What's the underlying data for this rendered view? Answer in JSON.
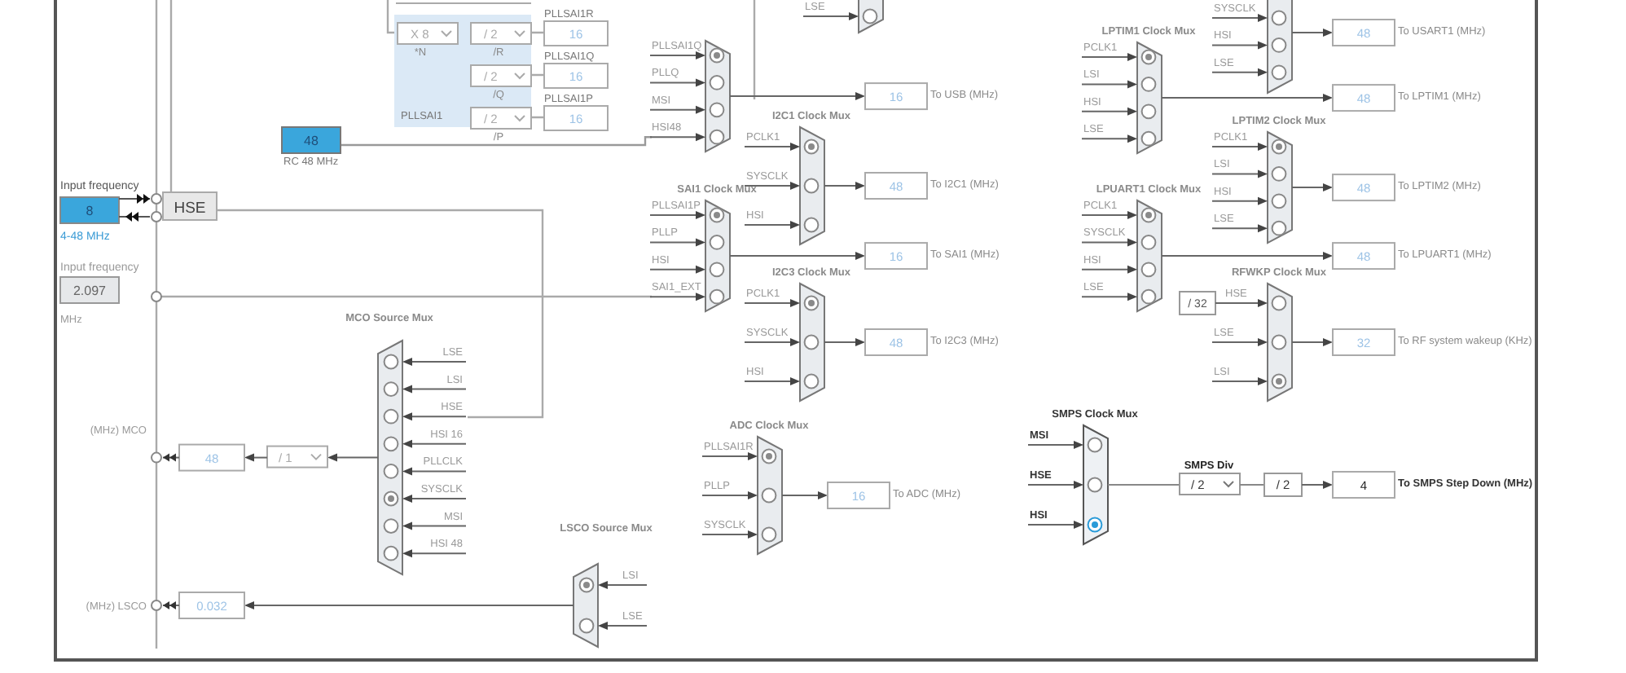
{
  "hse_input": {
    "label": "Input frequency",
    "value": "8",
    "range": "4-48 MHz",
    "source": "HSE",
    "disabled": false
  },
  "input_2": {
    "label": "Input frequency",
    "value": "2.097",
    "unit": "MHz",
    "disabled": true
  },
  "rc48": {
    "value": "48",
    "label": "RC 48 MHz"
  },
  "pllsai1": {
    "title": "PLLSAI1",
    "multiplier": {
      "value": "X 8",
      "label": "*N"
    },
    "dividers": [
      {
        "value": "/ 2",
        "label": "/R"
      },
      {
        "value": "/ 2",
        "label": "/Q"
      },
      {
        "value": "/ 2",
        "label": "/P"
      }
    ],
    "outputs": [
      {
        "label": "PLLSAI1R",
        "value": "16"
      },
      {
        "label": "PLLSAI1Q",
        "value": "16"
      },
      {
        "label": "PLLSAI1P",
        "value": "16"
      }
    ]
  },
  "muxes": [
    {
      "disabled": true,
      "inputs": [
        {
          "label": "LSE",
          "selected": false
        }
      ]
    },
    {
      "disabled": true,
      "inputs": [
        {
          "label": "PLLSAI1Q",
          "selected": true
        },
        {
          "label": "PLLQ",
          "selected": false
        },
        {
          "label": "MSI",
          "selected": false
        },
        {
          "label": "HSI48",
          "selected": false
        }
      ],
      "output": {
        "value": "16",
        "label": "To USB (MHz)"
      }
    },
    {
      "title": "I2C1 Clock Mux",
      "disabled": true,
      "inputs": [
        {
          "label": "PCLK1",
          "selected": true
        },
        {
          "label": "SYSCLK",
          "selected": false
        },
        {
          "label": "HSI",
          "selected": false
        }
      ],
      "output": {
        "value": "48",
        "label": "To I2C1 (MHz)"
      }
    },
    {
      "title": "SAI1 Clock Mux",
      "disabled": true,
      "inputs": [
        {
          "label": "PLLSAI1P",
          "selected": true
        },
        {
          "label": "PLLP",
          "selected": false
        },
        {
          "label": "HSI",
          "selected": false
        },
        {
          "label": "SAI1_EXT",
          "selected": false
        }
      ],
      "output": {
        "value": "16",
        "label": "To SAI1 (MHz)"
      }
    },
    {
      "title": "I2C3 Clock Mux",
      "disabled": true,
      "inputs": [
        {
          "label": "PCLK1",
          "selected": true
        },
        {
          "label": "SYSCLK",
          "selected": false
        },
        {
          "label": "HSI",
          "selected": false
        }
      ],
      "output": {
        "value": "48",
        "label": "To I2C3 (MHz)"
      }
    },
    {
      "title": "ADC Clock Mux",
      "disabled": true,
      "inputs": [
        {
          "label": "PLLSAI1R",
          "selected": true
        },
        {
          "label": "PLLP",
          "selected": false
        },
        {
          "label": "SYSCLK",
          "selected": false
        }
      ],
      "output": {
        "value": "16",
        "label": "To ADC (MHz)"
      }
    },
    {
      "disabled": true,
      "inputs": [
        {
          "label": "SYSCLK",
          "selected": false
        },
        {
          "label": "HSI",
          "selected": false
        },
        {
          "label": "LSE",
          "selected": false
        }
      ],
      "output": {
        "value": "48",
        "label": "To USART1 (MHz)"
      }
    },
    {
      "title": "LPTIM1 Clock Mux",
      "disabled": true,
      "inputs": [
        {
          "label": "PCLK1",
          "selected": true
        },
        {
          "label": "LSI",
          "selected": false
        },
        {
          "label": "HSI",
          "selected": false
        },
        {
          "label": "LSE",
          "selected": false
        }
      ],
      "output": {
        "value": "48",
        "label": "To LPTIM1 (MHz)"
      }
    },
    {
      "title": "LPTIM2 Clock Mux",
      "disabled": true,
      "inputs": [
        {
          "label": "PCLK1",
          "selected": true
        },
        {
          "label": "LSI",
          "selected": false
        },
        {
          "label": "HSI",
          "selected": false
        },
        {
          "label": "LSE",
          "selected": false
        }
      ],
      "output": {
        "value": "48",
        "label": "To LPTIM2 (MHz)"
      }
    },
    {
      "title": "LPUART1 Clock Mux",
      "disabled": true,
      "inputs": [
        {
          "label": "PCLK1",
          "selected": true
        },
        {
          "label": "SYSCLK",
          "selected": false
        },
        {
          "label": "HSI",
          "selected": false
        },
        {
          "label": "LSE",
          "selected": false
        }
      ],
      "output": {
        "value": "48",
        "label": "To LPUART1 (MHz)"
      }
    },
    {
      "title": "RFWKP Clock Mux",
      "disabled": true,
      "inputs": [
        {
          "label": "HSE",
          "prescaler": "/ 32",
          "selected": false
        },
        {
          "label": "LSE",
          "selected": false
        },
        {
          "label": "LSI",
          "selected": true
        }
      ],
      "output": {
        "value": "32",
        "label": "To RF system wakeup (KHz)"
      }
    },
    {
      "title": "SMPS Clock Mux",
      "disabled": false,
      "inputs": [
        {
          "label": "MSI",
          "selected": false
        },
        {
          "label": "HSE",
          "selected": false
        },
        {
          "label": "HSI",
          "selected": true
        }
      ],
      "chain": {
        "label": "SMPS Div",
        "dropdown": "/ 2",
        "fixed": "/ 2"
      },
      "output": {
        "value": "4",
        "label": "To SMPS Step Down (MHz)"
      }
    }
  ],
  "mco": {
    "title": "MCO Source Mux",
    "label": "(MHz) MCO",
    "value": "48",
    "divider": "/ 1",
    "inputs": [
      {
        "label": "LSE",
        "selected": false
      },
      {
        "label": "LSI",
        "selected": false
      },
      {
        "label": "HSE",
        "selected": false
      },
      {
        "label": "HSI 16",
        "selected": false
      },
      {
        "label": "PLLCLK",
        "selected": false
      },
      {
        "label": "SYSCLK",
        "selected": true
      },
      {
        "label": "MSI",
        "selected": false
      },
      {
        "label": "HSI 48",
        "selected": false
      }
    ]
  },
  "lsco": {
    "title": "LSCO Source Mux",
    "label": "(MHz) LSCO",
    "value": "0.032",
    "inputs": [
      {
        "label": "LSI",
        "selected": true
      },
      {
        "label": "LSE",
        "selected": false
      }
    ]
  }
}
